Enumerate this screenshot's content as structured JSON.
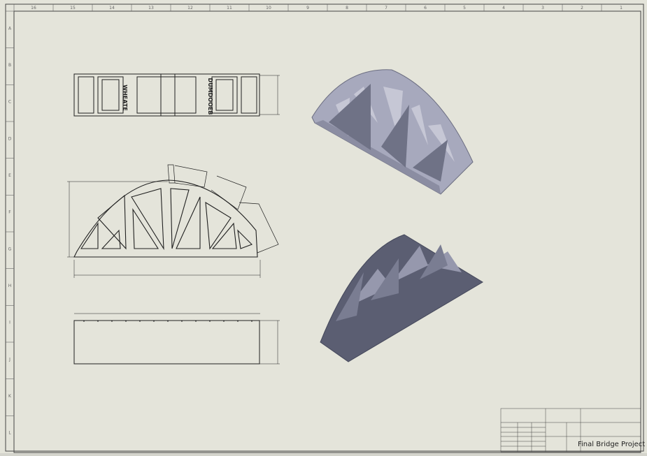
{
  "sheet": {
    "title_block": {
      "drawing_title": "Final Bridge Project"
    },
    "engraving_left": "WHEATE",
    "engraving_right": "DUMDOOEB",
    "border_col_labels": [
      "16",
      "15",
      "14",
      "13",
      "12",
      "11",
      "10",
      "9",
      "8",
      "7",
      "6",
      "5",
      "4",
      "3",
      "2",
      "1"
    ],
    "border_row_labels": [
      "A",
      "B",
      "C",
      "D",
      "E",
      "F",
      "G",
      "H",
      "I",
      "J",
      "K",
      "L"
    ]
  },
  "colors": {
    "paper": "#e4e4da",
    "line": "#202020",
    "model_light": "#a7a9bd",
    "model_dark": "#5b5e72"
  }
}
